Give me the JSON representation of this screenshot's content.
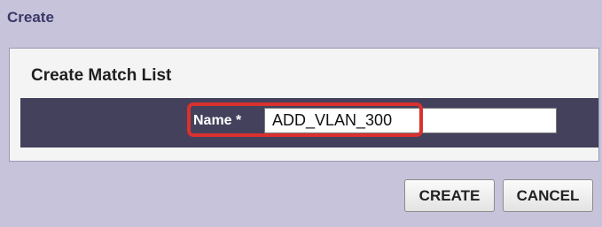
{
  "dialog": {
    "header": "Create",
    "title": "Create Match List",
    "name_label": "Name *",
    "name_value": "ADD_VLAN_300",
    "create_button": "CREATE",
    "cancel_button": "CANCEL"
  }
}
